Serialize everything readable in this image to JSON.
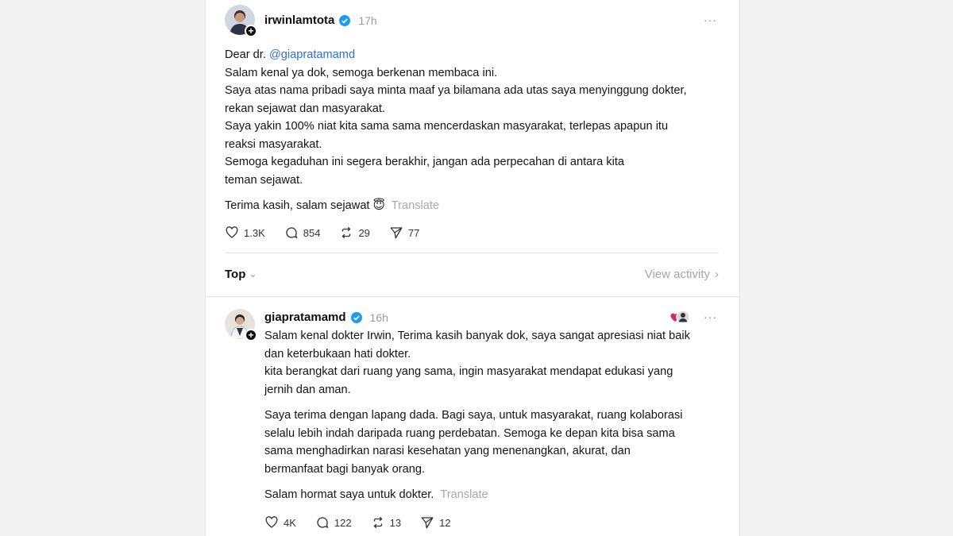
{
  "post": {
    "username": "irwinlamtota",
    "time": "17h",
    "more": "···",
    "greeting_prefix": "Dear dr. ",
    "mention": "@giapratamamd",
    "lines": [
      "Salam kenal ya dok, semoga berkenan membaca ini.",
      "Saya atas nama pribadi saya minta maaf ya bilamana ada utas saya menyinggung dokter,",
      "rekan sejawat dan masyarakat.",
      "Saya yakin 100% niat kita sama sama mencerdaskan masyarakat, terlepas apapun itu",
      "reaksi masyarakat.",
      "Semoga kegaduhan ini segera berakhir, jangan ada perpecahan di antara kita",
      "teman sejawat."
    ],
    "closing": "Terima kasih, salam sejawat",
    "closing_emoji": "😇",
    "translate": "Translate",
    "stats": {
      "likes": "1.3K",
      "replies": "854",
      "reposts": "29",
      "shares": "77"
    }
  },
  "sort": {
    "label": "Top",
    "activity": "View activity"
  },
  "reply": {
    "username": "giapratamamd",
    "time": "16h",
    "more": "···",
    "para1": [
      "Salam kenal dokter Irwin, Terima kasih banyak dok, saya sangat apresiasi niat baik",
      "dan keterbukaan hati dokter.",
      "kita berangkat dari ruang yang sama, ingin masyarakat mendapat edukasi yang",
      "jernih dan aman."
    ],
    "para2": [
      "Saya terima dengan lapang dada. Bagi saya, untuk masyarakat, ruang kolaborasi",
      "selalu lebih indah daripada ruang perdebatan. Semoga ke depan kita bisa sama",
      "sama menghadirkan narasi kesehatan yang menenangkan, akurat, dan",
      "bermanfaat bagi banyak orang."
    ],
    "closing": "Salam hormat saya untuk dokter.",
    "translate": "Translate",
    "stats": {
      "likes": "4K",
      "replies": "122",
      "reposts": "13",
      "shares": "12"
    }
  },
  "colors": {
    "mention": "#2f6fd6",
    "verified": "#1d9bf0",
    "muted": "#9a9a9a"
  }
}
